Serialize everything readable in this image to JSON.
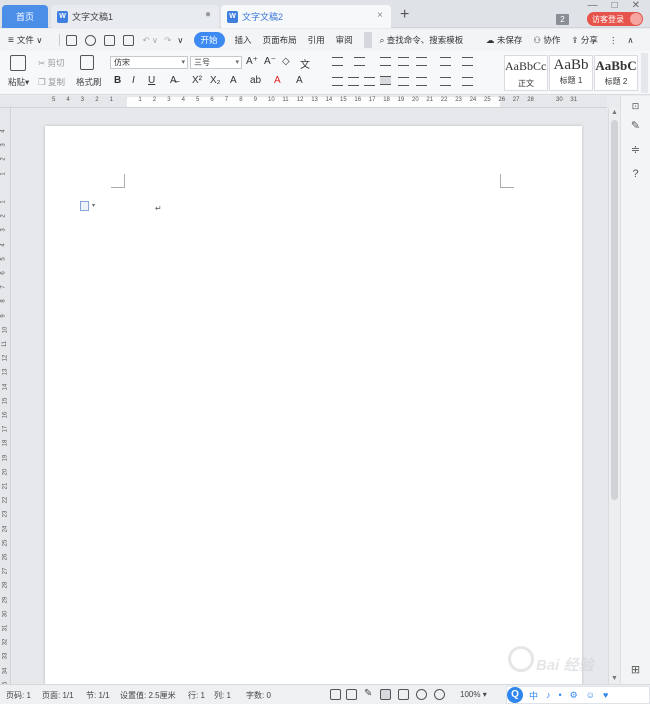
{
  "tabs": {
    "home": "首页",
    "doc1": "文字文稿1",
    "doc2": "文字文稿2",
    "doc_icon_letter": "W",
    "add": "+",
    "close": "×",
    "dot": "●"
  },
  "window": {
    "badge": "2",
    "login": "访客登录",
    "min": "—",
    "max": "□",
    "close": "✕"
  },
  "menu": {
    "file": "文件",
    "start": "开始",
    "insert": "插入",
    "page_layout": "页面布局",
    "references": "引用",
    "review": "审阅",
    "search": "查找命令、搜索模板",
    "unsaved": "未保存",
    "collab": "协作",
    "share": "分享"
  },
  "ribbon": {
    "paste": "粘贴",
    "cut": "剪切",
    "copy": "复制",
    "format_painter": "格式刷",
    "font_name": "仿宋",
    "font_size": "三号",
    "bold": "B",
    "italic": "I",
    "underline": "U",
    "styles": [
      {
        "sample": "AaBbCcDd",
        "name": "正文"
      },
      {
        "sample": "AaBb",
        "name": "标题 1"
      },
      {
        "sample": "AaBbC",
        "name": "标题 2"
      }
    ]
  },
  "ruler": {
    "h_ticks": [
      "5",
      "4",
      "3",
      "2",
      "1",
      "",
      "1",
      "2",
      "3",
      "4",
      "5",
      "6",
      "7",
      "8",
      "9",
      "10",
      "11",
      "12",
      "13",
      "14",
      "15",
      "16",
      "17",
      "18",
      "19",
      "20",
      "21",
      "22",
      "23",
      "24",
      "25",
      "26",
      "27",
      "28",
      "",
      "30",
      "31"
    ],
    "v_ticks": [
      "4",
      "3",
      "2",
      "1",
      "",
      "1",
      "2",
      "3",
      "4",
      "5",
      "6",
      "7",
      "8",
      "9",
      "10",
      "11",
      "12",
      "13",
      "14",
      "15",
      "16",
      "17",
      "18",
      "19",
      "20",
      "21",
      "22",
      "23",
      "24",
      "25",
      "26",
      "27",
      "28",
      "29",
      "30",
      "31",
      "32",
      "33",
      "34",
      "35"
    ]
  },
  "document": {
    "para_mark": "↵"
  },
  "status": {
    "page": "页码: 1",
    "pages": "页面: 1/1",
    "section": "节: 1/1",
    "setting": "设置值: 2.5厘米",
    "line": "行: 1",
    "col": "列: 1",
    "words": "字数: 0",
    "zoom": "100%",
    "ime": [
      "中",
      "♪",
      "•",
      "⚙",
      "☺",
      "♥"
    ]
  },
  "watermark": {
    "text": "Bai 经验"
  }
}
